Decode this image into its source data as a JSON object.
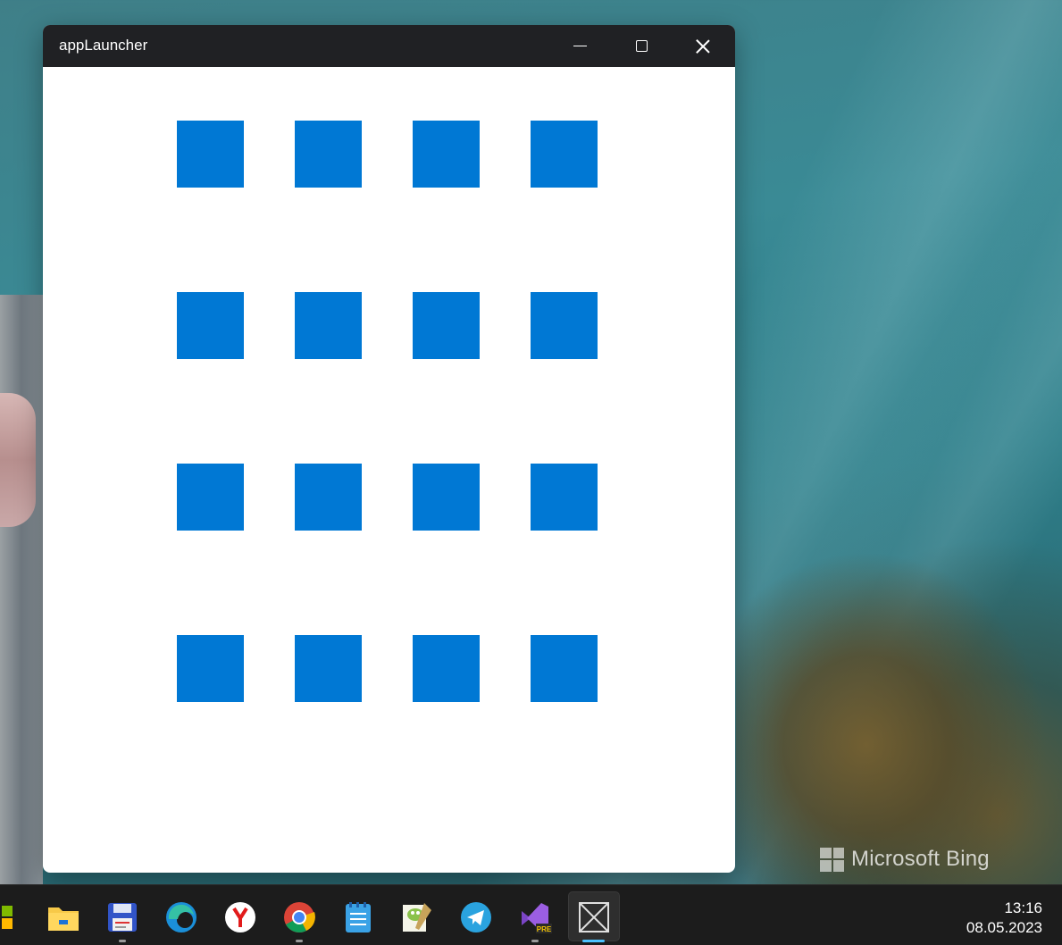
{
  "window": {
    "title": "appLauncher",
    "tile_color": "#0078d4",
    "tile_count": 16
  },
  "desktop": {
    "watermark_text": "Microsoft Bing"
  },
  "taskbar": {
    "icons": [
      "windows-start-icon",
      "file-explorer-icon",
      "floppy-disk-icon",
      "edge-icon",
      "yandex-browser-icon",
      "chrome-icon",
      "notepad-icon",
      "notepad-plus-plus-icon",
      "telegram-icon",
      "visual-studio-preview-icon",
      "applauncher-icon"
    ],
    "time": "13:16",
    "date": "08.05.2023"
  }
}
